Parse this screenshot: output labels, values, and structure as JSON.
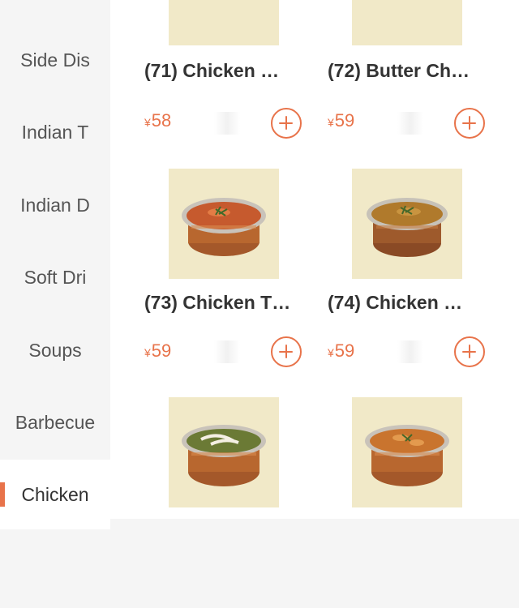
{
  "sidebar": {
    "categories": [
      {
        "label": "Side Dis",
        "active": false
      },
      {
        "label": "Indian T",
        "active": false
      },
      {
        "label": "Indian D",
        "active": false
      },
      {
        "label": "Soft Dri",
        "active": false
      },
      {
        "label": "Soups",
        "active": false
      },
      {
        "label": "Barbecue",
        "active": false
      },
      {
        "label": "Chicken",
        "active": true
      }
    ]
  },
  "products": [
    {
      "title": "(71) Chicken …",
      "currency": "¥",
      "price": "58",
      "image": "curry-bowl-image"
    },
    {
      "title": "(72) Butter Ch…",
      "currency": "¥",
      "price": "59",
      "image": "curry-bowl-image"
    },
    {
      "title": "(73) Chicken T…",
      "currency": "¥",
      "price": "59",
      "image": "curry-bowl-image"
    },
    {
      "title": "(74) Chicken …",
      "currency": "¥",
      "price": "59",
      "image": "curry-bowl-image"
    },
    {
      "title": "",
      "currency": "",
      "price": "",
      "image": "curry-bowl-image"
    },
    {
      "title": "",
      "currency": "",
      "price": "",
      "image": "curry-bowl-image"
    }
  ],
  "colors": {
    "accent": "#e8734a",
    "thumb_bg": "#f1e9c8",
    "sidebar_bg": "#f5f5f5",
    "text": "#333333"
  },
  "icons": {
    "add": "plus-circle-icon"
  }
}
